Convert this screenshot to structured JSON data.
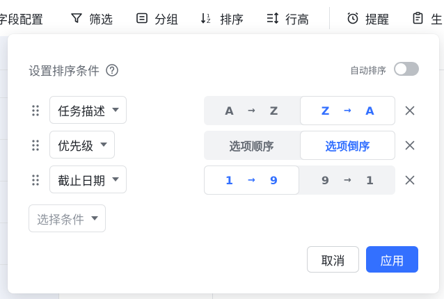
{
  "toolbar": {
    "items": [
      {
        "label": "字段配置",
        "icon": "field-config-icon"
      },
      {
        "label": "筛选",
        "icon": "filter-icon"
      },
      {
        "label": "分组",
        "icon": "group-icon"
      },
      {
        "label": "排序",
        "icon": "sort-icon"
      },
      {
        "label": "行高",
        "icon": "row-height-icon"
      },
      {
        "label": "提醒",
        "icon": "alarm-clock-icon"
      },
      {
        "label": "生",
        "icon": "clipboard-icon"
      }
    ]
  },
  "popup": {
    "title": "设置排序条件",
    "auto_sort_label": "自动排序",
    "auto_sort_enabled": false,
    "rows": [
      {
        "field": "任务描述",
        "left": {
          "a": "A",
          "arrow": "→",
          "b": "Z"
        },
        "right": {
          "a": "Z",
          "arrow": "→",
          "b": "A"
        },
        "active": "right"
      },
      {
        "field": "优先级",
        "left": {
          "label": "选项顺序"
        },
        "right": {
          "label": "选项倒序"
        },
        "active": "right"
      },
      {
        "field": "截止日期",
        "left": {
          "a": "1",
          "arrow": "→",
          "b": "9"
        },
        "right": {
          "a": "9",
          "arrow": "→",
          "b": "1"
        },
        "active": "left"
      }
    ],
    "add_condition_placeholder": "选择条件",
    "cancel_label": "取消",
    "apply_label": "应用"
  },
  "colors": {
    "accent": "#3370ff",
    "text_primary": "#1f2329",
    "text_secondary": "#646a73",
    "segment_bg": "#f2f3f5",
    "toggle_off": "#bbbfc4"
  }
}
